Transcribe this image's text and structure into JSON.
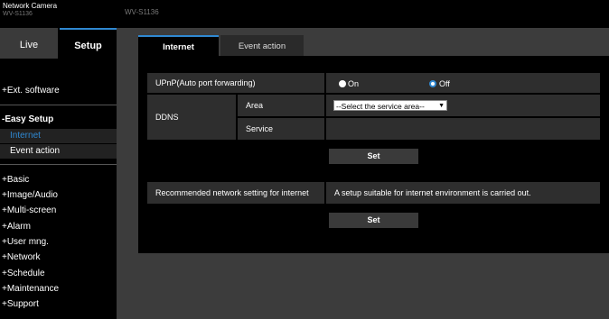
{
  "header": {
    "brand_title": "Network Camera",
    "brand_sub": "WV-S1136",
    "model_name": "WV-S1136"
  },
  "sidebar": {
    "tabs": {
      "live": "Live",
      "setup": "Setup"
    },
    "ext_software": "+Ext. software",
    "easy_setup": {
      "title": "-Easy Setup",
      "items": [
        "Internet",
        "Event action"
      ]
    },
    "menu": [
      "+Basic",
      "+Image/Audio",
      "+Multi-screen",
      "+Alarm",
      "+User mng.",
      "+Network",
      "+Schedule",
      "+Maintenance",
      "+Support"
    ]
  },
  "tabs": [
    "Internet",
    "Event action"
  ],
  "form": {
    "upnp_label": "UPnP(Auto port forwarding)",
    "upnp_on": "On",
    "upnp_off": "Off",
    "upnp_value": "Off",
    "ddns_label": "DDNS",
    "area_label": "Area",
    "area_value": "--Select the service area--",
    "service_label": "Service",
    "set_label": "Set",
    "recommended_label": "Recommended network setting for internet",
    "recommended_desc": "A setup suitable for internet environment is carried out.",
    "set2_label": "Set"
  },
  "colors": {
    "accent": "#2f88d1",
    "cell": "#2e2e2e"
  }
}
